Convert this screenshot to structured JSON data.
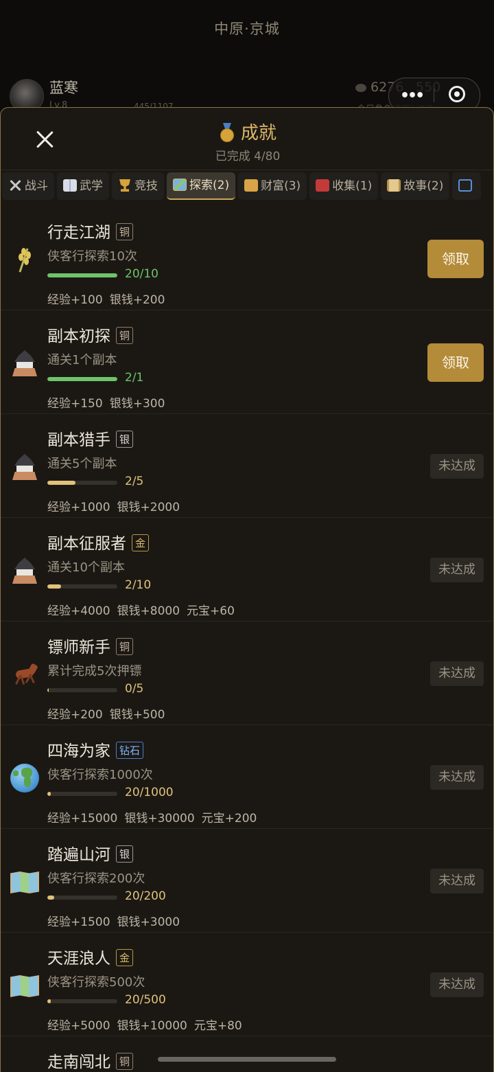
{
  "header": {
    "location": "中原·京城",
    "player_name": "蓝寒",
    "player_level": "Lv.8",
    "player_extra": "445/1107",
    "currency1": "6276",
    "currency2": "550",
    "daily_text": "今日角色进度：0/2"
  },
  "sheet": {
    "title": "成就",
    "subtitle": "已完成 4/80"
  },
  "tabs": [
    {
      "label": "战斗",
      "icon": "crossed-swords-icon"
    },
    {
      "label": "武学",
      "icon": "book-icon"
    },
    {
      "label": "竞技",
      "icon": "trophy-icon"
    },
    {
      "label": "探索(2)",
      "icon": "map-icon",
      "active": true
    },
    {
      "label": "财富(3)",
      "icon": "money-bag-icon"
    },
    {
      "label": "收集(1)",
      "icon": "gift-icon"
    },
    {
      "label": "故事(2)",
      "icon": "scroll-icon"
    },
    {
      "label": "",
      "icon": "cycle-icon"
    }
  ],
  "achievements": [
    {
      "name": "行走江湖",
      "tier": "铜",
      "desc": "侠客行探索10次",
      "progress": "20/10",
      "fraction": 1.0,
      "done": true,
      "rewards": [
        "经验+100",
        "银钱+200"
      ],
      "action": "领取",
      "icon": "wheat-icon"
    },
    {
      "name": "副本初探",
      "tier": "铜",
      "desc": "通关1个副本",
      "progress": "2/1",
      "fraction": 1.0,
      "done": true,
      "rewards": [
        "经验+150",
        "银钱+300"
      ],
      "action": "领取",
      "icon": "castle-icon"
    },
    {
      "name": "副本猎手",
      "tier": "银",
      "desc": "通关5个副本",
      "progress": "2/5",
      "fraction": 0.4,
      "done": false,
      "rewards": [
        "经验+1000",
        "银钱+2000"
      ],
      "action": "未达成",
      "icon": "castle-icon"
    },
    {
      "name": "副本征服者",
      "tier": "金",
      "desc": "通关10个副本",
      "progress": "2/10",
      "fraction": 0.2,
      "done": false,
      "rewards": [
        "经验+4000",
        "银钱+8000",
        "元宝+60"
      ],
      "action": "未达成",
      "icon": "castle-icon"
    },
    {
      "name": "镖师新手",
      "tier": "铜",
      "desc": "累计完成5次押镖",
      "progress": "0/5",
      "fraction": 0.0,
      "done": false,
      "rewards": [
        "经验+200",
        "银钱+500"
      ],
      "action": "未达成",
      "icon": "horse-icon"
    },
    {
      "name": "四海为家",
      "tier": "钻石",
      "desc": "侠客行探索1000次",
      "progress": "20/1000",
      "fraction": 0.02,
      "done": false,
      "rewards": [
        "经验+15000",
        "银钱+30000",
        "元宝+200"
      ],
      "action": "未达成",
      "icon": "globe-icon"
    },
    {
      "name": "踏遍山河",
      "tier": "银",
      "desc": "侠客行探索200次",
      "progress": "20/200",
      "fraction": 0.1,
      "done": false,
      "rewards": [
        "经验+1500",
        "银钱+3000"
      ],
      "action": "未达成",
      "icon": "world-map-icon"
    },
    {
      "name": "天涯浪人",
      "tier": "金",
      "desc": "侠客行探索500次",
      "progress": "20/500",
      "fraction": 0.04,
      "done": false,
      "rewards": [
        "经验+5000",
        "银钱+10000",
        "元宝+80"
      ],
      "action": "未达成",
      "icon": "world-map-icon"
    }
  ],
  "partial_item": {
    "name": "走南闯北",
    "tier": "铜"
  },
  "colors": {
    "accent": "#b48b38",
    "done": "#6ec46a",
    "progress": "#e0c27a"
  }
}
